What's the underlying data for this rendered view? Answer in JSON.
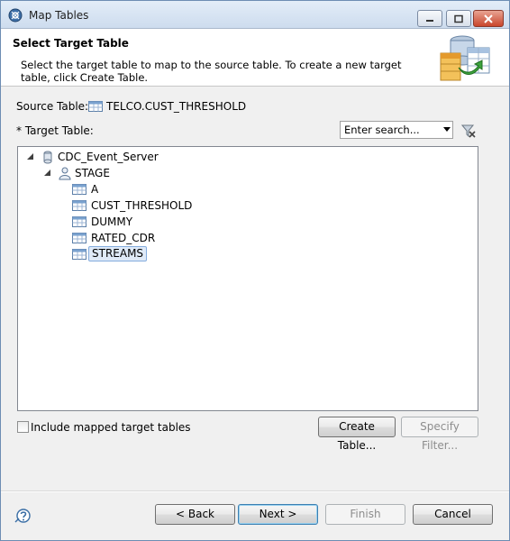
{
  "window": {
    "title": "Map Tables",
    "controls": [
      "minimize-icon",
      "maximize-icon",
      "close-icon"
    ]
  },
  "header": {
    "title": "Select Target Table",
    "description": "Select the target table to map to the source table. To create a new target table, click Create Table."
  },
  "source": {
    "label": "Source Table:",
    "value": "TELCO.CUST_THRESHOLD",
    "icon": "table-icon"
  },
  "target": {
    "label": "* Target Table:",
    "search_placeholder": "Enter search...",
    "clear_icon": "clear-filter-icon"
  },
  "tree": {
    "server": "CDC_Event_Server",
    "schema": "STAGE",
    "tables": [
      "A",
      "CUST_THRESHOLD",
      "DUMMY",
      "RATED_CDR",
      "STREAMS"
    ],
    "selected": "STREAMS"
  },
  "options": {
    "include_mapped_label": "Include mapped target tables",
    "include_mapped_checked": false,
    "create_table_label": "Create Table...",
    "specify_filter_label": "Specify Filter..."
  },
  "footer": {
    "back_label": "< Back",
    "next_label": "Next >",
    "finish_label": "Finish",
    "cancel_label": "Cancel"
  }
}
